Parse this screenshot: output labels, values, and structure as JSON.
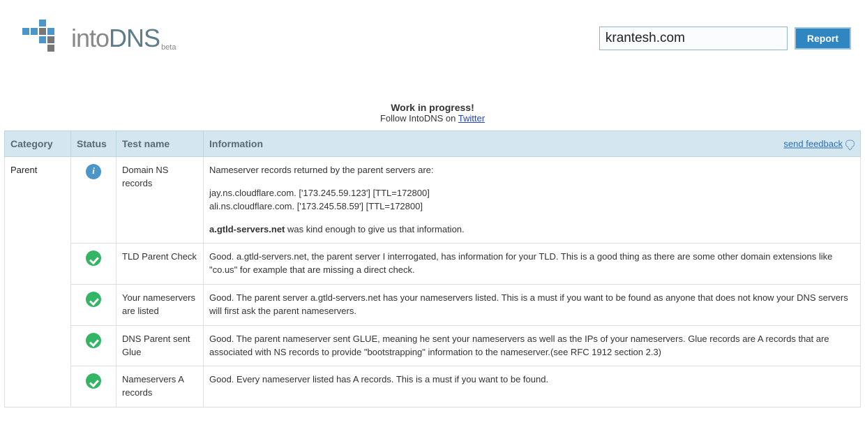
{
  "logo": {
    "prefix": "into",
    "suffix": "DNS",
    "beta": "beta"
  },
  "search": {
    "value": "krantesh.com",
    "button": "Report"
  },
  "notice": {
    "wip": "Work in progress!",
    "follow_prefix": "Follow IntoDNS on ",
    "twitter": "Twitter"
  },
  "table": {
    "headers": {
      "category": "Category",
      "status": "Status",
      "testname": "Test name",
      "information": "Information"
    },
    "feedback": "send feedback",
    "category": "Parent",
    "rows": [
      {
        "status": "info",
        "name": "Domain NS records",
        "info_intro": "Nameserver records returned by the parent servers are:",
        "ns1": "jay.ns.cloudflare.com.   ['173.245.59.123']   [TTL=172800]",
        "ns2": "ali.ns.cloudflare.com.   ['173.245.58.59']   [TTL=172800]",
        "info_server_bold": "a.gtld-servers.net",
        "info_server_rest": " was kind enough to give us that information."
      },
      {
        "status": "ok",
        "name": "TLD Parent Check",
        "text": "Good. a.gtld-servers.net, the parent server I interrogated, has information for your TLD. This is a good thing as there are some other domain extensions like \"co.us\" for example that are missing a direct check."
      },
      {
        "status": "ok",
        "name": "Your nameservers are listed",
        "text": "Good. The parent server a.gtld-servers.net has your nameservers listed. This is a must if you want to be found as anyone that does not know your DNS servers will first ask the parent nameservers."
      },
      {
        "status": "ok",
        "name": "DNS Parent sent Glue",
        "text": "Good. The parent nameserver sent GLUE, meaning he sent your nameservers as well as the IPs of your nameservers. Glue records are A records that are associated with NS records to provide \"bootstrapping\" information to the nameserver.(see RFC 1912 section 2.3)"
      },
      {
        "status": "ok",
        "name": "Nameservers A records",
        "text": "Good. Every nameserver listed has A records. This is a must if you want to be found."
      }
    ]
  }
}
